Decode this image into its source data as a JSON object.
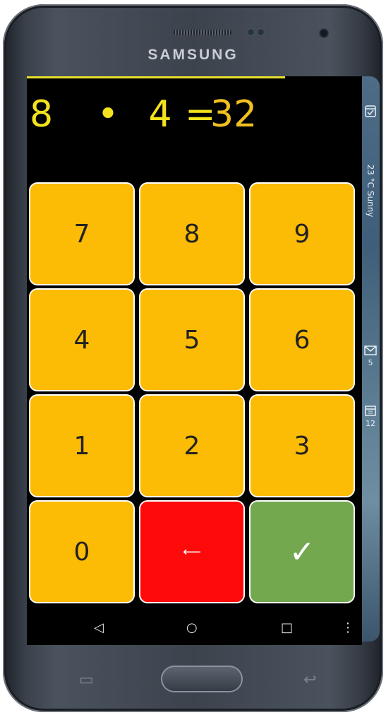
{
  "device": {
    "brand": "SAMSUNG",
    "icons": {
      "speaker": "speaker-grille",
      "camera": "front-camera",
      "recent": "recent-apps-icon",
      "back": "back-arrow-icon"
    }
  },
  "edge_panel": {
    "items": [
      {
        "icon": "calendar-check-icon",
        "text": ""
      },
      {
        "icon": "weather",
        "text": "23 °C Sunny"
      },
      {
        "icon": "mail-icon",
        "text": "5"
      },
      {
        "icon": "calendar-icon",
        "text": "12"
      }
    ]
  },
  "progress": {
    "fraction": 0.77,
    "color": "#e9e12c"
  },
  "equation": {
    "operand1": "8",
    "operator": "•",
    "operand2": "4",
    "equals": "=",
    "answer": "32",
    "color": "#f3e21c",
    "answer_color": "#f0c020"
  },
  "keypad": {
    "keys": [
      "7",
      "8",
      "9",
      "4",
      "5",
      "6",
      "1",
      "2",
      "3",
      "0"
    ],
    "delete_icon": "backspace-arrow-icon",
    "delete_label": "⟵",
    "confirm_icon": "checkmark-icon",
    "confirm_label": "✓",
    "colors": {
      "digit": "#fcbb04",
      "delete": "#ff0a0a",
      "confirm": "#73a84f"
    }
  },
  "navbar": {
    "back": "◁",
    "home": "○",
    "recent": "□",
    "menu": "⋮"
  },
  "hardware": {
    "recent_glyph": "▭",
    "back_glyph": "↩"
  }
}
